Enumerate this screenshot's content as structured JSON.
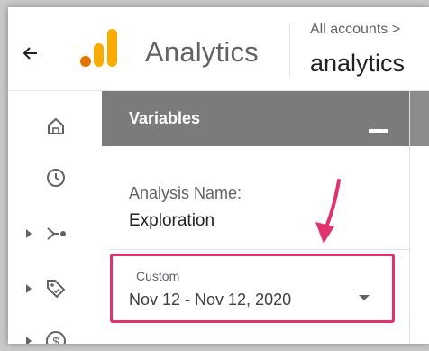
{
  "header": {
    "app_title": "Analytics",
    "breadcrumb": "All accounts > ",
    "property_name": "analytics"
  },
  "nav": {
    "items": [
      {
        "icon": "home-icon",
        "has_caret": false
      },
      {
        "icon": "reports-clock-icon",
        "has_caret": false
      },
      {
        "icon": "explore-icon",
        "has_caret": true
      },
      {
        "icon": "advertising-tag-icon",
        "has_caret": true
      },
      {
        "icon": "monetization-dollar-icon",
        "has_caret": true
      }
    ]
  },
  "variables_panel": {
    "title": "Variables",
    "analysis_name_label": "Analysis Name:",
    "analysis_name_value": "Exploration",
    "date_selector": {
      "mode": "Custom",
      "range": "Nov 12 - Nov 12, 2020"
    }
  },
  "colors": {
    "panel_header": "#7b7b7b",
    "highlight": "#e0336e",
    "logo_orange": "#f9ab00",
    "logo_dark_orange": "#e37400"
  }
}
